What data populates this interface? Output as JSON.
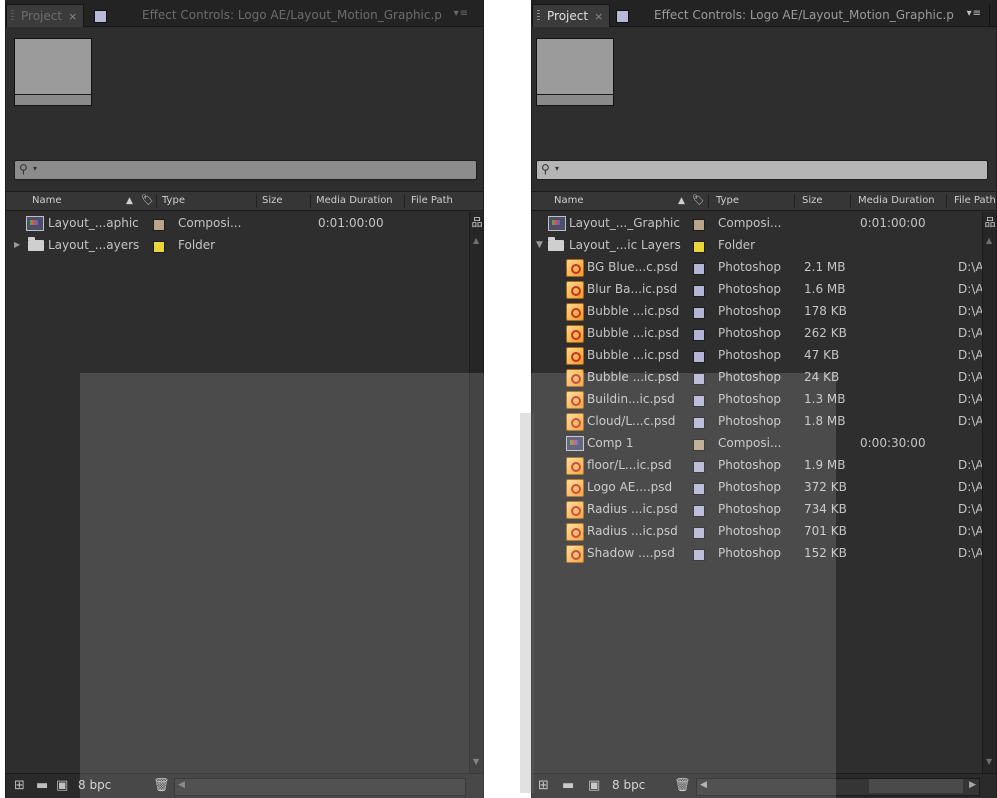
{
  "tabs": {
    "project_label": "Project",
    "close_glyph": "×",
    "effects_label": "Effect Controls: Logo AE/Layout_Motion_Graphic.p",
    "menu_glyph": "▾≡"
  },
  "search": {
    "glyph": "⚲",
    "dropdown": "▾"
  },
  "columns": {
    "name": "Name",
    "sort_glyph": "▲",
    "label_glyph": "🏷",
    "type": "Type",
    "size": "Size",
    "media_duration": "Media Duration",
    "file_path": "File Path"
  },
  "panel_left": {
    "rows": [
      {
        "name": "Layout_...aphic",
        "type": "Composi...",
        "size": "",
        "duration": "0:01:00:00",
        "path": "",
        "icon": "composition-icon",
        "color": "#b9a58a"
      },
      {
        "name": "Layout_...ayers",
        "type": "Folder",
        "size": "",
        "duration": "",
        "path": "",
        "icon": "folder-icon",
        "color": "#e8d63a",
        "expander": "▶"
      }
    ]
  },
  "panel_right": {
    "rows": [
      {
        "name": "Layout_..._Graphic",
        "type": "Composi...",
        "size": "",
        "duration": "0:01:00:00",
        "path": "",
        "icon": "composition-icon",
        "color": "#b9a58a",
        "indent": 0
      },
      {
        "name": "Layout_...ic Layers",
        "type": "Folder",
        "size": "",
        "duration": "",
        "path": "",
        "icon": "folder-icon",
        "color": "#e8d63a",
        "indent": 0,
        "expander": "▼"
      },
      {
        "name": "BG Blue...c.psd",
        "type": "Photoshop",
        "size": "2.1 MB",
        "duration": "",
        "path": "D:\\A",
        "icon": "photoshop-file-icon",
        "color": "#b4b4d6",
        "indent": 1
      },
      {
        "name": "Blur Ba...ic.psd",
        "type": "Photoshop",
        "size": "1.6 MB",
        "duration": "",
        "path": "D:\\A",
        "icon": "photoshop-file-icon",
        "color": "#b4b4d6",
        "indent": 1
      },
      {
        "name": "Bubble ...ic.psd",
        "type": "Photoshop",
        "size": "178 KB",
        "duration": "",
        "path": "D:\\A",
        "icon": "photoshop-file-icon",
        "color": "#b4b4d6",
        "indent": 1
      },
      {
        "name": "Bubble ...ic.psd",
        "type": "Photoshop",
        "size": "262 KB",
        "duration": "",
        "path": "D:\\A",
        "icon": "photoshop-file-icon",
        "color": "#b4b4d6",
        "indent": 1
      },
      {
        "name": "Bubble ...ic.psd",
        "type": "Photoshop",
        "size": "47 KB",
        "duration": "",
        "path": "D:\\A",
        "icon": "photoshop-file-icon",
        "color": "#b4b4d6",
        "indent": 1
      },
      {
        "name": "Bubble ...ic.psd",
        "type": "Photoshop",
        "size": "24 KB",
        "duration": "",
        "path": "D:\\A",
        "icon": "photoshop-file-icon",
        "color": "#b4b4d6",
        "indent": 1
      },
      {
        "name": "Buildin...ic.psd",
        "type": "Photoshop",
        "size": "1.3 MB",
        "duration": "",
        "path": "D:\\A",
        "icon": "photoshop-file-icon",
        "color": "#b4b4d6",
        "indent": 1
      },
      {
        "name": "Cloud/L...c.psd",
        "type": "Photoshop",
        "size": "1.8 MB",
        "duration": "",
        "path": "D:\\A",
        "icon": "photoshop-file-icon",
        "color": "#b4b4d6",
        "indent": 1
      },
      {
        "name": "Comp 1",
        "type": "Composi...",
        "size": "",
        "duration": "0:00:30:00",
        "path": "",
        "icon": "composition-icon",
        "color": "#b9a58a",
        "indent": 1
      },
      {
        "name": "floor/L...ic.psd",
        "type": "Photoshop",
        "size": "1.9 MB",
        "duration": "",
        "path": "D:\\A",
        "icon": "photoshop-file-icon",
        "color": "#b4b4d6",
        "indent": 1
      },
      {
        "name": "Logo AE....psd",
        "type": "Photoshop",
        "size": "372 KB",
        "duration": "",
        "path": "D:\\A",
        "icon": "photoshop-file-icon",
        "color": "#b4b4d6",
        "indent": 1
      },
      {
        "name": "Radius ...ic.psd",
        "type": "Photoshop",
        "size": "734 KB",
        "duration": "",
        "path": "D:\\A",
        "icon": "photoshop-file-icon",
        "color": "#b4b4d6",
        "indent": 1
      },
      {
        "name": "Radius ...ic.psd",
        "type": "Photoshop",
        "size": "701 KB",
        "duration": "",
        "path": "D:\\A",
        "icon": "photoshop-file-icon",
        "color": "#b4b4d6",
        "indent": 1
      },
      {
        "name": "Shadow ....psd",
        "type": "Photoshop",
        "size": "152 KB",
        "duration": "",
        "path": "D:\\A",
        "icon": "photoshop-file-icon",
        "color": "#b4b4d6",
        "indent": 1
      }
    ]
  },
  "footer": {
    "bpc_label": "8 bpc",
    "flowchart_glyph": "品",
    "trash_glyph": "🗑",
    "left_arrow": "◀",
    "right_arrow": "▶"
  }
}
